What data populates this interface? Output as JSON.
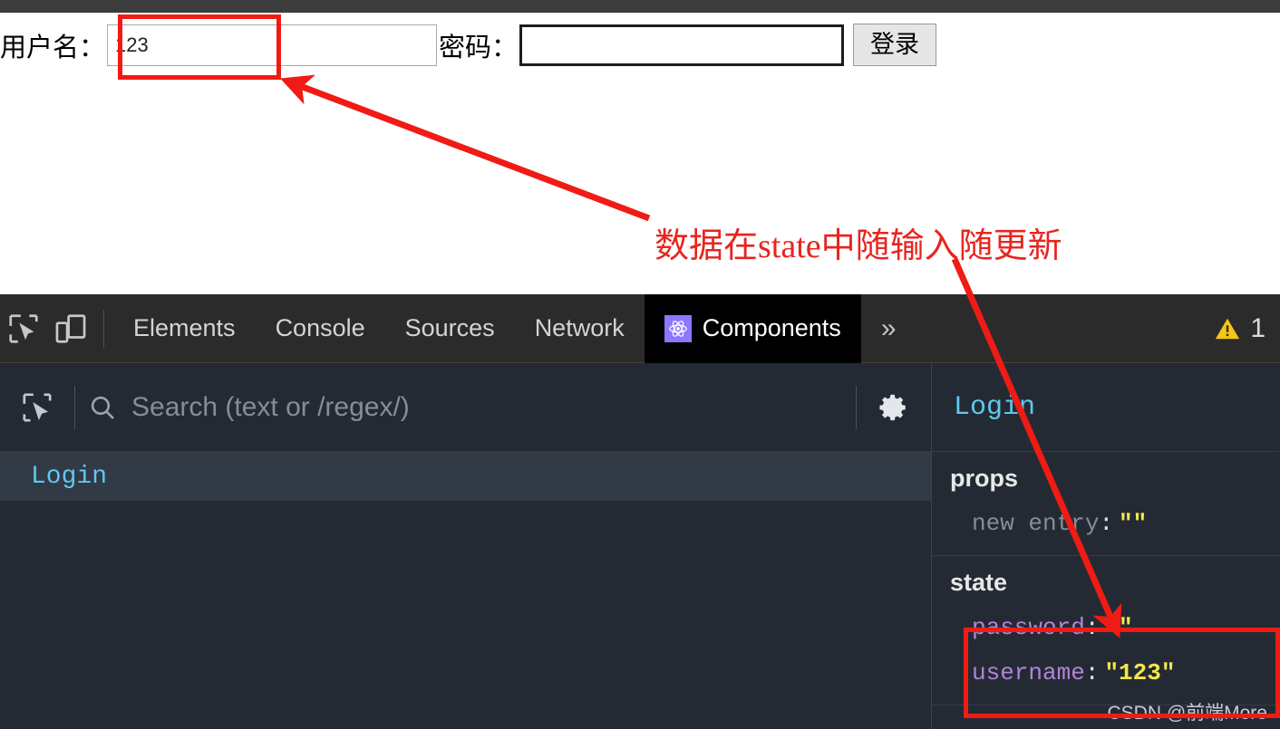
{
  "login_form": {
    "username_label": "用户名：",
    "username_value": "123",
    "password_label": "密码：",
    "password_value": "",
    "submit_label": "登录"
  },
  "annotations": {
    "note_text": "数据在state中随输入随更新",
    "highlight_color": "#f01b15",
    "text_color": "#e8251f"
  },
  "devtools": {
    "tabs": [
      {
        "label": "Elements",
        "active": false
      },
      {
        "label": "Console",
        "active": false
      },
      {
        "label": "Sources",
        "active": false
      },
      {
        "label": "Network",
        "active": false
      },
      {
        "label": "Components",
        "active": true,
        "icon": "react-atom-icon"
      }
    ],
    "more_tabs_label": "»",
    "warning_count": "1",
    "inspect_icon": "inspect-element-icon",
    "device_icon": "device-toolbar-icon",
    "search": {
      "placeholder": "Search (text or /regex/)",
      "value": "",
      "search_icon": "search-icon",
      "settings_icon": "gear-icon",
      "select_icon": "select-element-icon"
    },
    "tree": {
      "items": [
        {
          "label": "Login",
          "selected": true
        }
      ]
    },
    "inspector": {
      "component_name": "Login",
      "sections": [
        {
          "name": "props",
          "title": "props",
          "rows": [
            {
              "key": "new entry",
              "value": "\"\"",
              "muted_key": true
            }
          ]
        },
        {
          "name": "state",
          "title": "state",
          "rows": [
            {
              "key": "password",
              "value": "\"\"",
              "muted_key": false
            },
            {
              "key": "username",
              "value": "\"123\"",
              "muted_key": false
            }
          ]
        }
      ]
    }
  },
  "watermark": "CSDN @前端More"
}
